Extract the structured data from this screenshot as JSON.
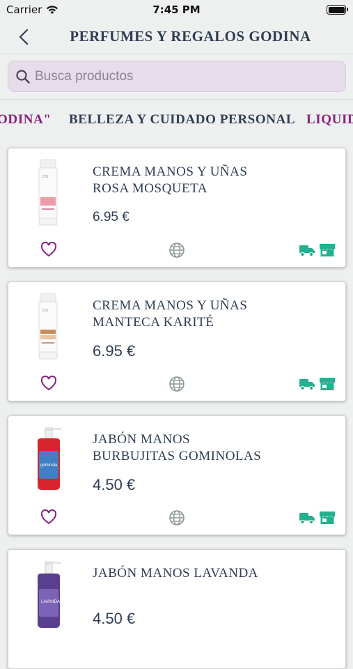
{
  "status_bar": {
    "carrier": "Carrier",
    "time": "7:45 PM"
  },
  "nav": {
    "title": "PERFUMES Y REGALOS GODINA",
    "back_icon": "chevron-left-icon"
  },
  "search": {
    "placeholder": "Busca productos",
    "icon": "search-icon"
  },
  "categories": [
    {
      "label": "ODINA\"",
      "selected": true
    },
    {
      "label": "BELLEZA Y CUIDADO PERSONAL",
      "selected": false
    },
    {
      "label": "LIQUID",
      "selected": false
    }
  ],
  "products": [
    {
      "name": "CREMA MANOS Y UÑAS\nROSA MOSQUETA",
      "price": "6.95 €",
      "image": "white-cream-tube-pink-label"
    },
    {
      "name": "CREMA MANOS Y UÑAS\nMANTECA KARITÉ",
      "price": "6.95 €",
      "image": "white-cream-tube-brown-label"
    },
    {
      "name": "JABÓN MANOS\nBURBUJITAS GOMINOLAS",
      "price": "4.50 €",
      "image": "red-soap-pump-bottle"
    },
    {
      "name": "JABÓN MANOS  LAVANDA",
      "price": "4.50 €",
      "image": "purple-soap-pump-bottle"
    }
  ],
  "colors": {
    "accent_purple": "#8a1f7e",
    "title_navy": "#2f3d52",
    "teal_icons": "#23b08e",
    "search_bg": "#e6dcea"
  }
}
